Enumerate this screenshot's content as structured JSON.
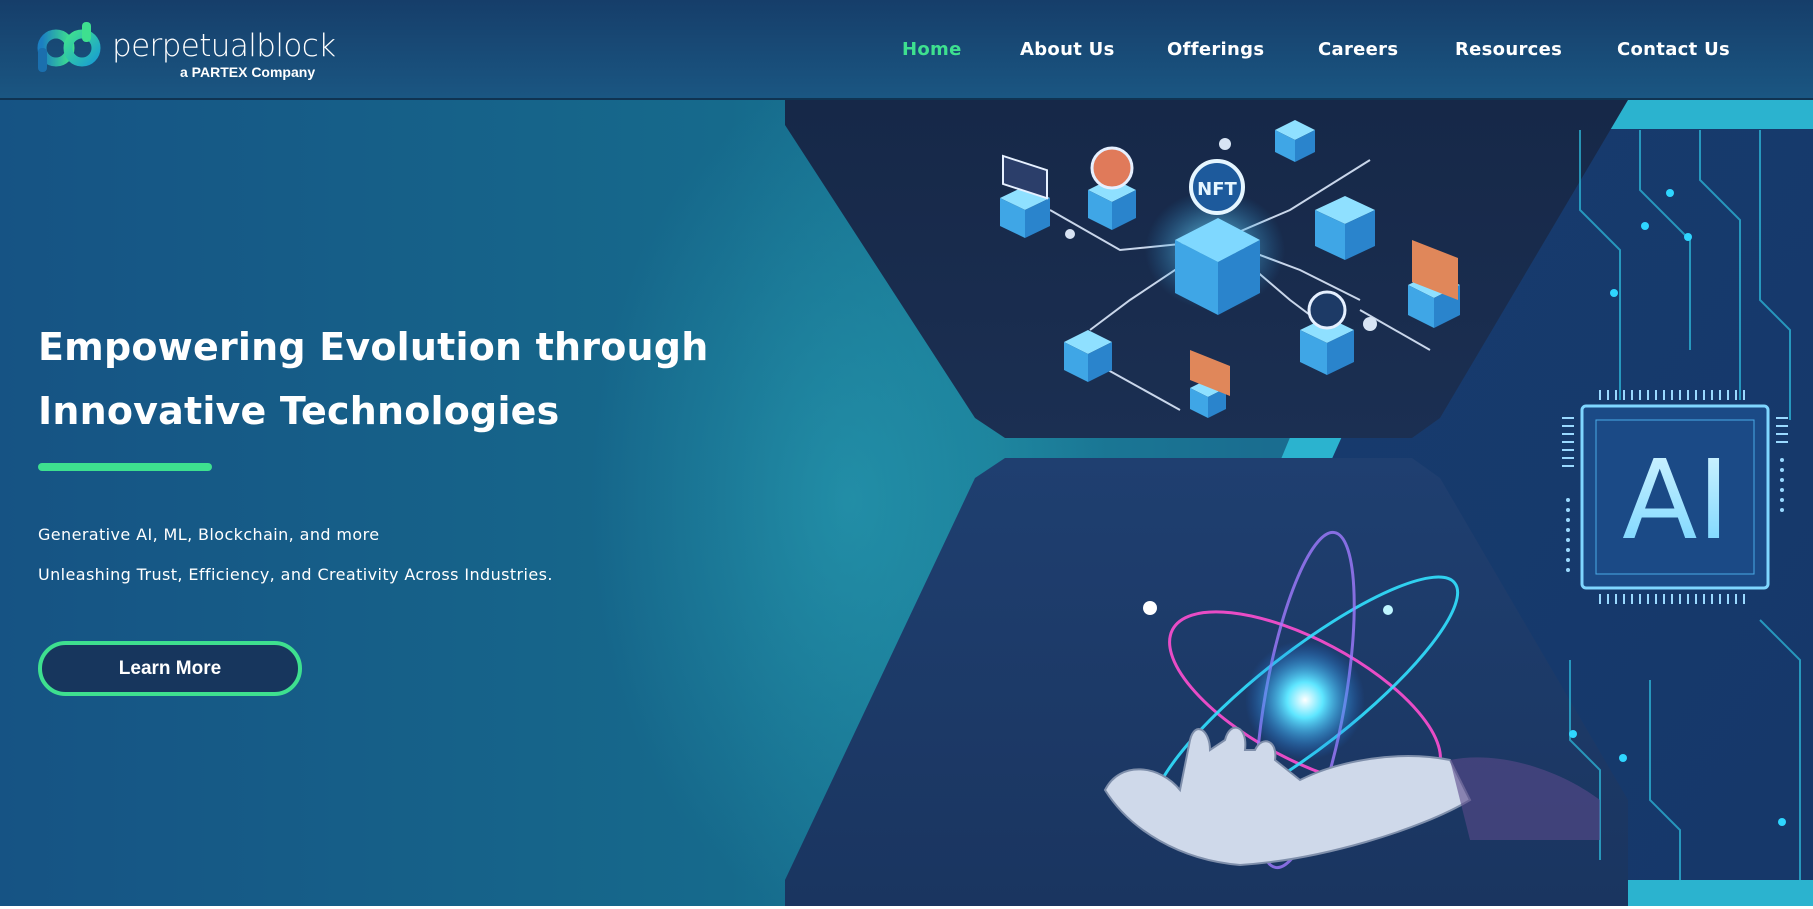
{
  "brand": {
    "name_part1": "perpetual",
    "name_part2": "block",
    "tagline": "a PARTEX Company"
  },
  "nav": {
    "items": [
      {
        "label": "Home",
        "active": true
      },
      {
        "label": "About Us",
        "active": false
      },
      {
        "label": "Offerings",
        "active": false
      },
      {
        "label": "Careers",
        "active": false
      },
      {
        "label": "Resources",
        "active": false
      },
      {
        "label": "Contact Us",
        "active": false
      }
    ]
  },
  "hero": {
    "title_line1": "Empowering Evolution through",
    "title_line2": "Innovative Technologies",
    "subtitle1": "Generative AI, ML, Blockchain, and more",
    "subtitle2": "Unleashing Trust, Efficiency, and Creativity Across Industries.",
    "cta_label": "Learn More",
    "ai_chip_text": "AI",
    "nft_badge_text": "NFT"
  },
  "colors": {
    "accent_green": "#3ee08f",
    "nav_bg": "#163e6a",
    "hero_bg": "#166a8c",
    "panel_dark": "#172a4a",
    "cyan": "#29c4e8"
  },
  "icons": [
    "perpetualblock-logo-icon",
    "nft-network-illustration",
    "ai-chip-illustration",
    "robot-hand-atom-illustration",
    "circuit-lines-illustration"
  ]
}
